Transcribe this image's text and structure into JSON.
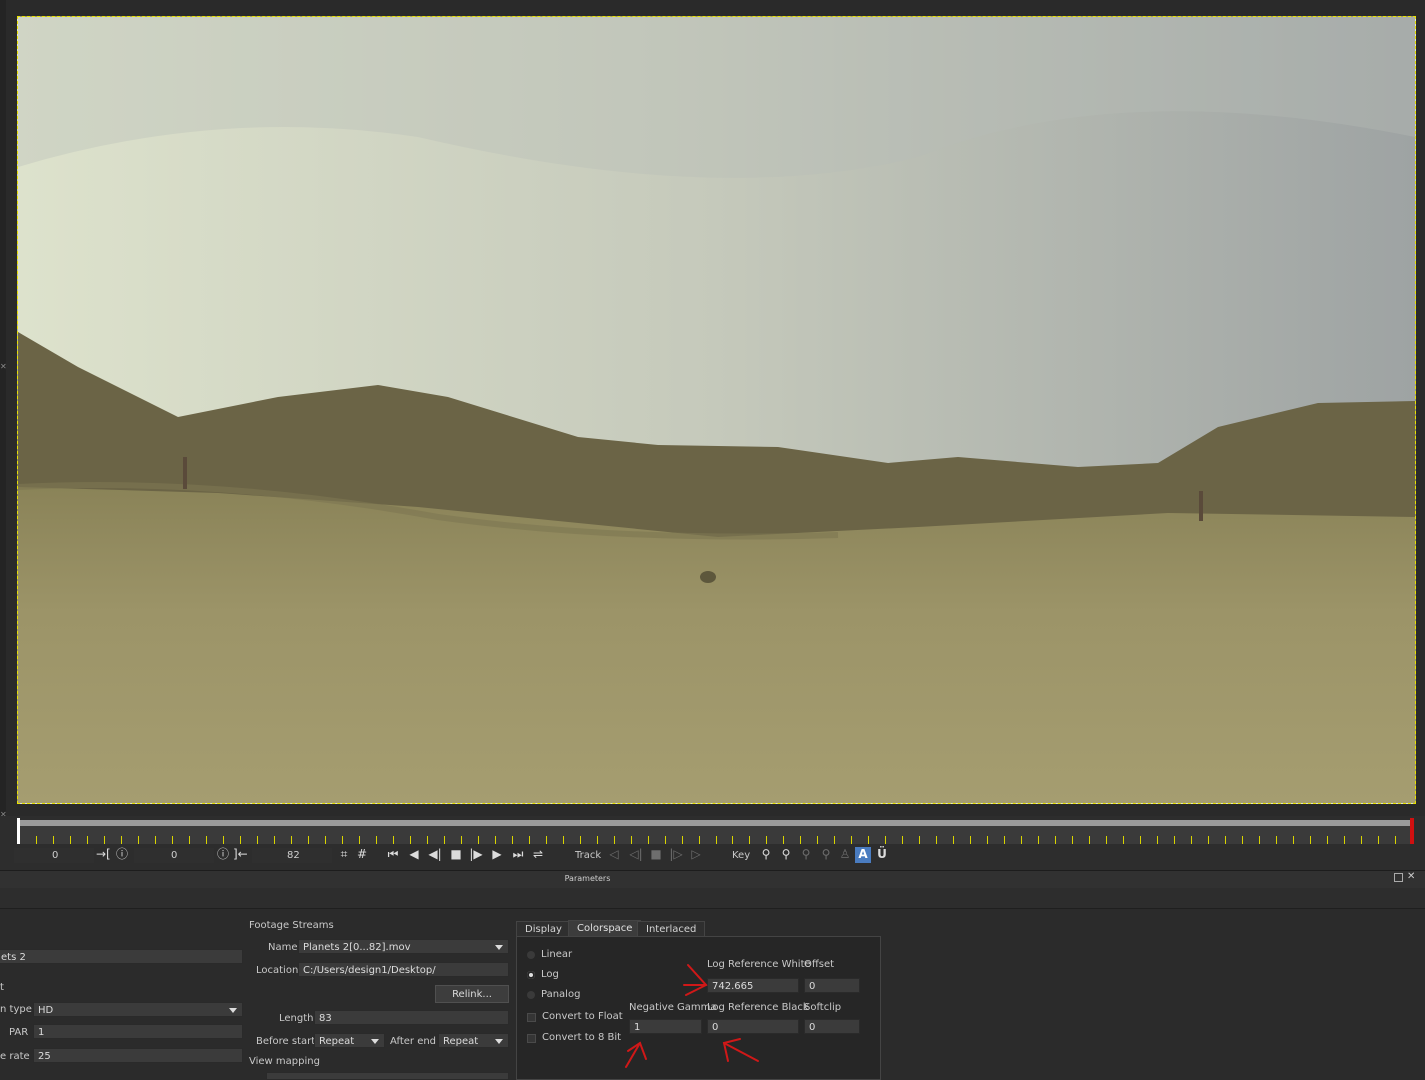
{
  "timeline": {
    "current_frame": "0",
    "in_point": "0",
    "out_point": "82",
    "track_label": "Track",
    "key_label": "Key"
  },
  "params_panel": {
    "title": "Parameters"
  },
  "left": {
    "name_value": "ets 2",
    "section_label": "t",
    "format_type_label": "n type",
    "format_type_value": "HD",
    "par_label": "PAR",
    "par_value": "1",
    "frame_rate_label": "e rate",
    "frame_rate_value": "25"
  },
  "footage": {
    "section_title": "Footage Streams",
    "name_label": "Name",
    "name_value": "Planets 2[0...82].mov",
    "location_label": "Location",
    "location_value": "C:/Users/design1/Desktop/",
    "relink_label": "Relink...",
    "length_label": "Length",
    "length_value": "83",
    "before_start_label": "Before start",
    "before_start_value": "Repeat",
    "after_end_label": "After end",
    "after_end_value": "Repeat",
    "view_mapping_label": "View mapping"
  },
  "tabs": [
    "Display",
    "Colorspace",
    "Interlaced"
  ],
  "colorspace": {
    "radio_linear": "Linear",
    "radio_log": "Log",
    "radio_panalog": "Panalog",
    "convert_float": "Convert to Float",
    "convert_8bit": "Convert to 8 Bit",
    "log_ref_white_label": "Log Reference White",
    "log_ref_white_value": "742.665",
    "offset_label": "Offset",
    "offset_value": "0",
    "negative_gamma_label": "Negative Gamma",
    "negative_gamma_value": "1",
    "log_ref_black_label": "Log Reference Black",
    "log_ref_black_value": "0",
    "softclip_label": "Softclip",
    "softclip_value": "0"
  },
  "colors": {
    "roi_border": "#e8e200",
    "annotation_arrow": "#d01818",
    "end_marker": "#d01010"
  }
}
